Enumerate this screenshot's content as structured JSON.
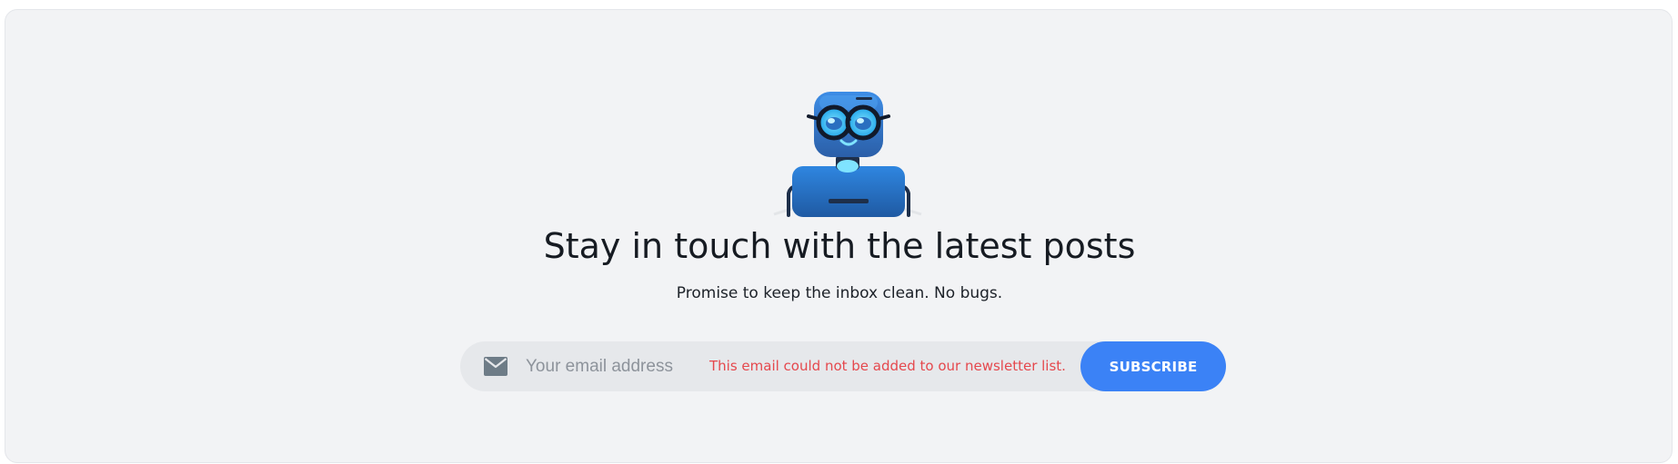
{
  "newsletter": {
    "illustration": "robot-with-glasses-mascot",
    "headline": "Stay in touch with the latest posts",
    "subline": "Promise to keep the inbox clean. No bugs.",
    "email_icon": "envelope-icon",
    "email_placeholder": "Your email address",
    "email_value": "",
    "error_message": "This email could not be added to our newsletter list.",
    "subscribe_label": "SUBSCRIBE"
  },
  "colors": {
    "card_background": "#f2f3f5",
    "form_background": "#e6e8eb",
    "accent": "#3b82f6",
    "error": "#e5484d",
    "text": "#161b22"
  }
}
